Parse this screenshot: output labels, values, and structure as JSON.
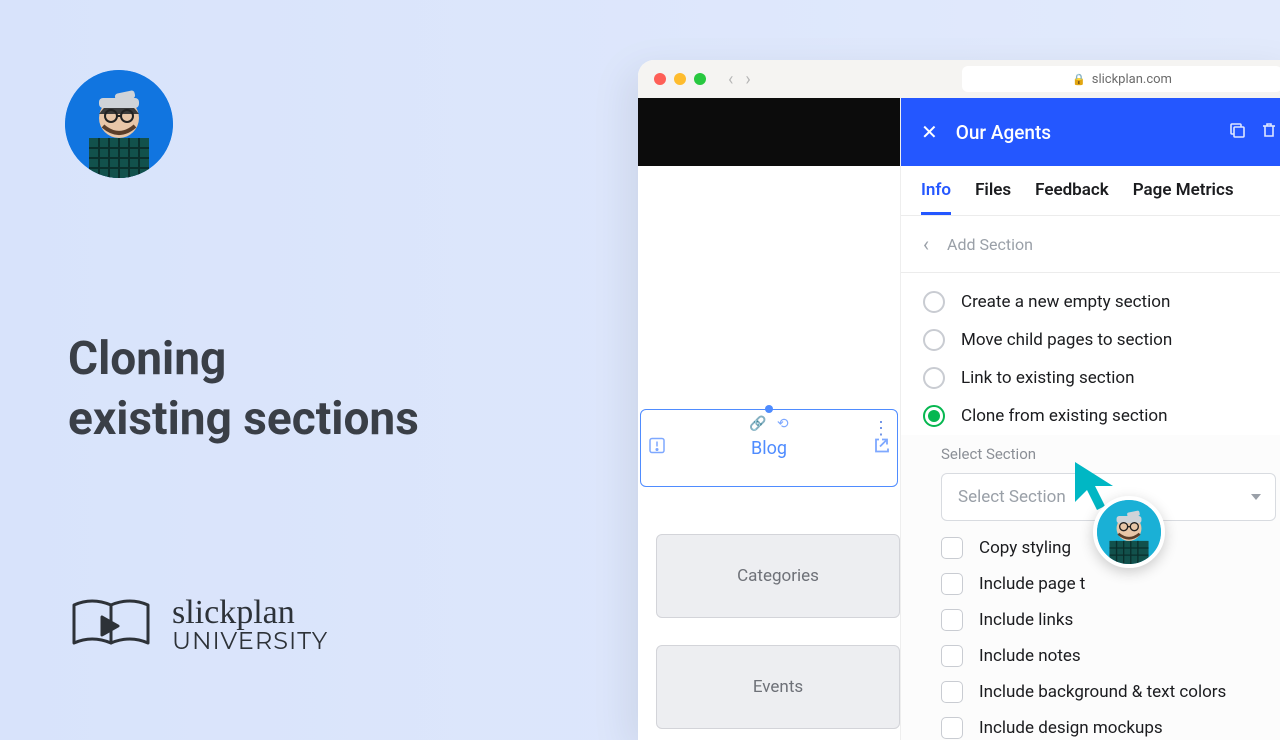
{
  "headline_line1": "Cloning",
  "headline_line2": "existing sections",
  "university": {
    "script": "slickplan",
    "caps": "UNIVERSITY"
  },
  "browser": {
    "address": "slickplan.com"
  },
  "panel": {
    "title": "Our Agents",
    "tabs": [
      "Info",
      "Files",
      "Feedback",
      "Page Metrics"
    ],
    "active_tab": 0,
    "breadcrumb": "Add Section",
    "radios": [
      "Create a new empty section",
      "Move child pages to section",
      "Link to existing section",
      "Clone from existing section"
    ],
    "selected_radio": 3,
    "select_label": "Select Section",
    "select_placeholder": "Select Section",
    "checks": [
      "Copy styling",
      "Include page t",
      "Include links",
      "Include notes",
      "Include background & text colors",
      "Include design mockups"
    ]
  },
  "canvas": {
    "blog": "Blog",
    "categories": "Categories",
    "events": "Events"
  }
}
